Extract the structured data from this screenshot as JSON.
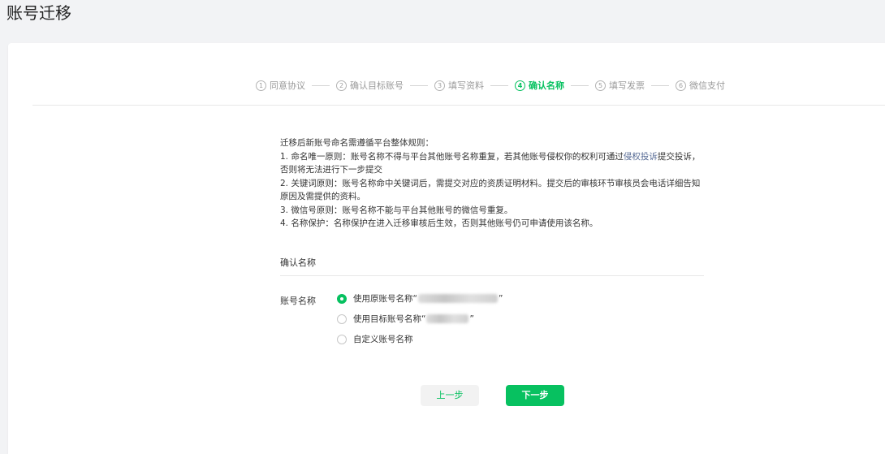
{
  "page": {
    "title": "账号迁移"
  },
  "steps": [
    {
      "num": "1",
      "label": "同意协议",
      "active": false
    },
    {
      "num": "2",
      "label": "确认目标账号",
      "active": false
    },
    {
      "num": "3",
      "label": "填写资料",
      "active": false
    },
    {
      "num": "4",
      "label": "确认名称",
      "active": true
    },
    {
      "num": "5",
      "label": "填写发票",
      "active": false
    },
    {
      "num": "6",
      "label": "微信支付",
      "active": false
    }
  ],
  "rules": {
    "intro": "迁移后新账号命名需遵循平台整体规则：",
    "rule1_a": "1. 命名唯一原则：账号名称不得与平台其他账号名称重复，若其他账号侵权你的权利可通过",
    "rule1_link": "侵权投诉",
    "rule1_b": "提交投诉，",
    "rule1_c": "否则将无法进行下一步提交",
    "rule2": "2. 关键词原则：账号名称命中关键词后，需提交对应的资质证明材料。提交后的审核环节审核员会电话详细告知原因及需提供的资料。",
    "rule3": "3. 微信号原则：账号名称不能与平台其他账号的微信号重复。",
    "rule4": "4. 名称保护：名称保护在进入迁移审核后生效，否则其他账号仍可申请使用该名称。"
  },
  "confirm": {
    "section_title": "确认名称",
    "field_label": "账号名称",
    "options": [
      {
        "prefix": "使用原账号名称“",
        "suffix": "”",
        "checked": true
      },
      {
        "prefix": "使用目标账号名称“",
        "suffix": "”",
        "checked": false
      },
      {
        "prefix": "自定义账号名称",
        "suffix": "",
        "checked": false
      }
    ]
  },
  "buttons": {
    "prev": "上一步",
    "next": "下一步"
  },
  "colors": {
    "accent": "#07c160",
    "link": "#576b95",
    "text": "#353535",
    "muted": "#9a9a9a"
  }
}
